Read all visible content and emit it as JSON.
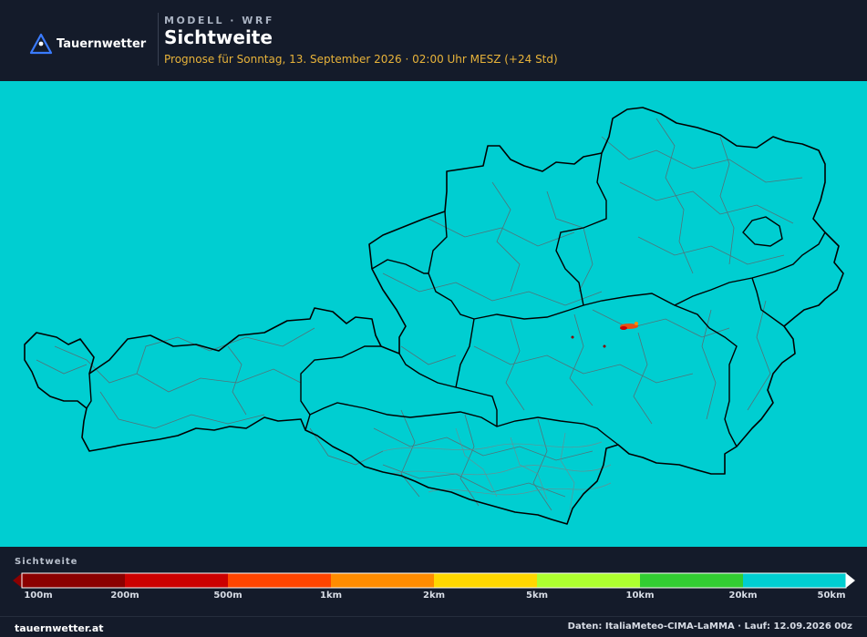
{
  "header": {
    "brand": "Tauernwetter",
    "kicker": "MODELL · WRF",
    "title": "Sichtweite",
    "subtitle": "Prognose für Sonntag, 13. September 2026 · 02:00 Uhr MESZ  (+24 Std)"
  },
  "map": {
    "background_color": "#00ced1",
    "border_color": "#000000",
    "district_color": "#5a6a70"
  },
  "legend": {
    "title": "Sichtweite",
    "colors": [
      "#8b0000",
      "#cc0000",
      "#ff4500",
      "#ff8c00",
      "#ffd700",
      "#adff2f",
      "#32cd32",
      "#00ced1"
    ],
    "ticks": [
      "100m",
      "200m",
      "500m",
      "1km",
      "2km",
      "5km",
      "10km",
      "20km",
      "50km"
    ]
  },
  "footer": {
    "site": "tauernwetter.at",
    "source": "Daten: ItaliaMeteo-CIMA-LaMMA · Lauf: 12.09.2026 00z"
  }
}
